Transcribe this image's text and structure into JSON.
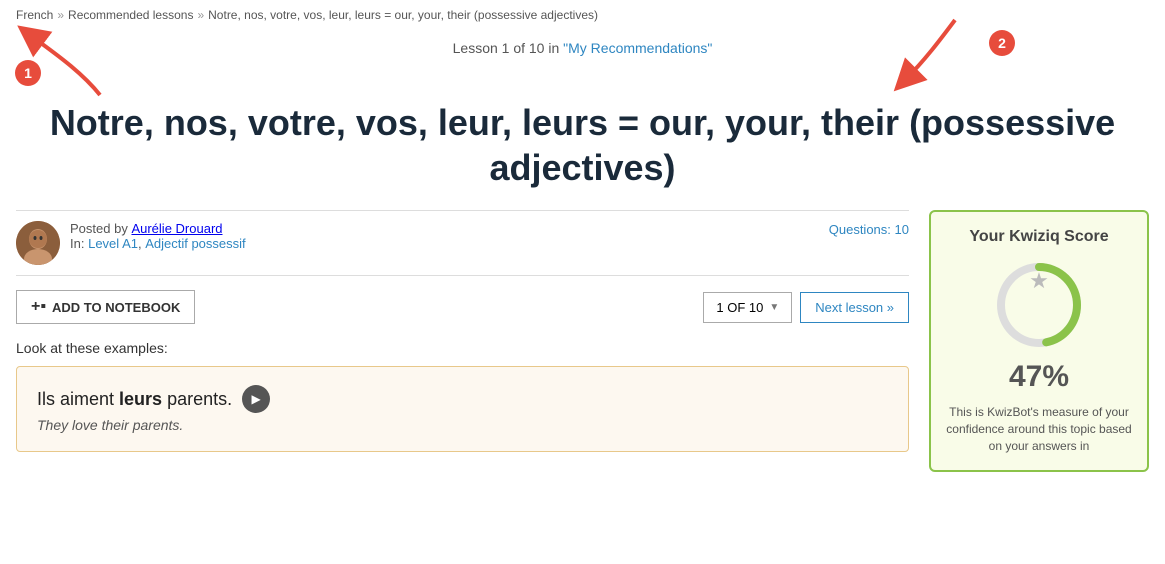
{
  "breadcrumb": {
    "items": [
      {
        "label": "French",
        "href": "#"
      },
      {
        "label": "Recommended lessons",
        "href": "#"
      },
      {
        "label": "Notre, nos, votre, vos, leur, leurs = our, your, their (possessive adjectives)",
        "href": "#"
      }
    ],
    "separator": "»"
  },
  "lesson": {
    "meta": "Lesson 1 of 10 in",
    "meta_link_text": "\"My Recommendations\"",
    "title": "Notre, nos, votre, vos, leur, leurs = our, your, their (possessive adjectives)",
    "author_prefix": "Posted by",
    "author_name": "Aurélie Drouard",
    "in_prefix": "In:",
    "level": "Level A1",
    "tag": "Adjectif possessif",
    "questions_label": "Questions:",
    "questions_count": "10",
    "add_notebook_label": "ADD TO NOTEBOOK",
    "lesson_counter": "1 OF 10",
    "next_lesson_label": "Next lesson »",
    "examples_intro": "Look at these examples:",
    "example_french": "Ils aiment leurs parents.",
    "example_bold_word": "leurs",
    "example_translation": "They love their parents."
  },
  "sidebar": {
    "score_title": "Your Kwiziq Score",
    "score_value": "47%",
    "score_description": "This is KwizBot's measure of your confidence around this topic based on your answers in"
  },
  "annotations": {
    "badge_1": "1",
    "badge_2": "2"
  }
}
